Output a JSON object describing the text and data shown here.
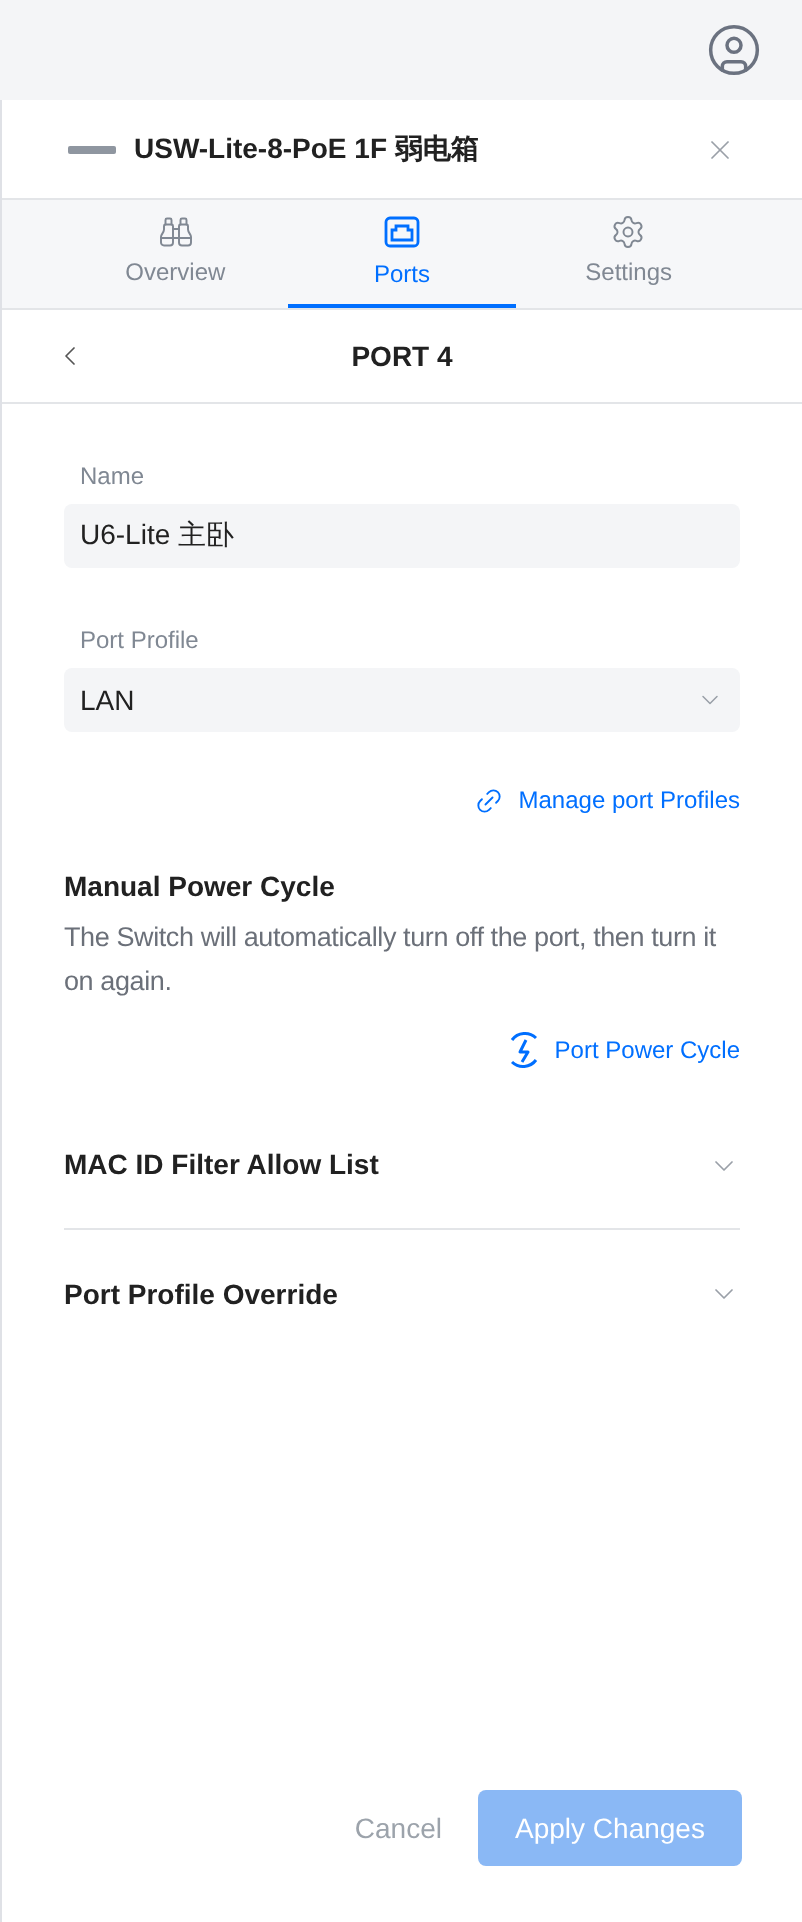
{
  "header": {
    "title": "USW-Lite-8-PoE 1F 弱电箱"
  },
  "tabs": [
    {
      "label": "Overview",
      "kind": "overview",
      "selected": false
    },
    {
      "label": "Ports",
      "kind": "ports",
      "selected": true
    },
    {
      "label": "Settings",
      "kind": "settings",
      "selected": false
    }
  ],
  "port": {
    "title": "PORT 4"
  },
  "name_field": {
    "label": "Name",
    "value": "U6-Lite 主卧"
  },
  "profile_field": {
    "label": "Port Profile",
    "value": "LAN"
  },
  "manage_link": "Manage port Profiles",
  "power_cycle": {
    "title": "Manual Power Cycle",
    "description": "The Switch will automatically turn off the port, then turn it on again.",
    "action": "Port Power Cycle"
  },
  "sections": [
    {
      "title": "MAC ID Filter Allow List",
      "expanded": false
    },
    {
      "title": "Port Profile Override",
      "expanded": false
    }
  ],
  "actions": {
    "cancel": {
      "label": "Cancel",
      "disabled": true
    },
    "apply": {
      "label": "Apply Changes",
      "disabled": true
    }
  }
}
